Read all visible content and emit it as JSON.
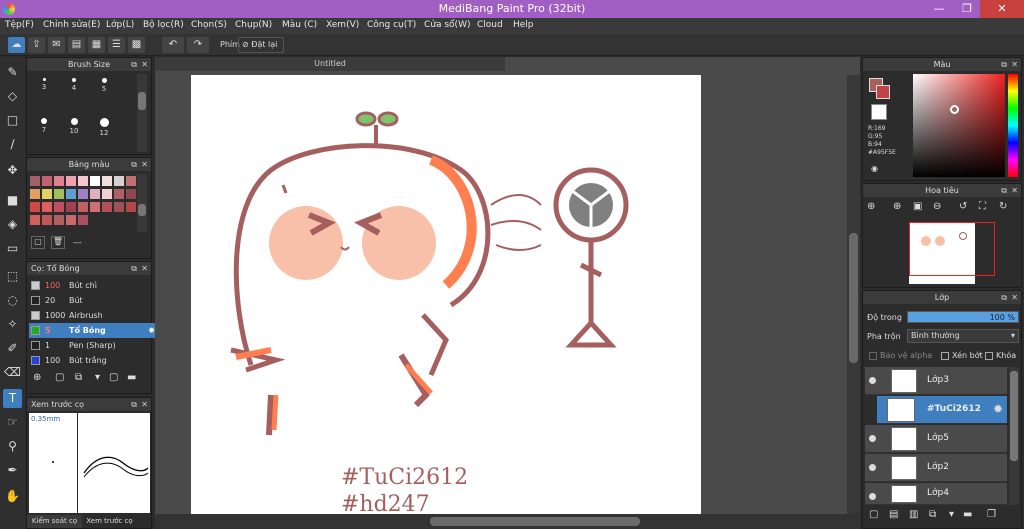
{
  "window": {
    "title": "MediBang Paint Pro (32bit)",
    "minimize": "—",
    "maximize": "❐",
    "close": "✕"
  },
  "menu": [
    "Tệp(F)",
    "Chỉnh sửa(E)",
    "Lớp(L)",
    "Bộ lọc(R)",
    "Chọn(S)",
    "Chụp(N)",
    "Màu (C)",
    "Xem(V)",
    "Công cụ(T)",
    "Cửa sổ(W)",
    "Cloud",
    "Help"
  ],
  "toolbar": {
    "phim_label": "Phím",
    "reset_label": "Đặt lại"
  },
  "brush_size": {
    "title": "Brush Size",
    "sizes": [
      "3",
      "4",
      "5",
      "7",
      "10",
      "12"
    ]
  },
  "palette": {
    "title": "Bảng màu",
    "footer": "---",
    "colors": [
      "#a0606a",
      "#c06070",
      "#e08090",
      "#f0a0b0",
      "#f7c7d0",
      "#ffffff",
      "#f0e0e0",
      "#d8d0d0",
      "#c07070",
      "#e0a060",
      "#e0d060",
      "#a0c060",
      "#60a0d0",
      "#a080c0",
      "#e0b0c0",
      "#f0d0d0",
      "#b06068",
      "#904850",
      "#d04848",
      "#e06060",
      "#c05060",
      "#a04050",
      "#c06060",
      "#d07070",
      "#b05058",
      "#a05058",
      "#b04848",
      "#d06060",
      "#c05858",
      "#b06060",
      "#c86868",
      "#a85060"
    ]
  },
  "brush_panel": {
    "title": "Cọ: Tổ Bóng",
    "brushes": [
      {
        "size": "100",
        "name": "Bút chì",
        "color": "#cccccc"
      },
      {
        "size": "20",
        "name": "Bút",
        "color": "#222222"
      },
      {
        "size": "1000",
        "name": "Airbrush",
        "color": "#cccccc"
      },
      {
        "size": "5",
        "name": "Tổ Bóng",
        "color": "#22aa22"
      },
      {
        "size": "1",
        "name": "Pen (Sharp)",
        "color": "#222222"
      },
      {
        "size": "100",
        "name": "Bút trắng",
        "color": "#2244dd"
      }
    ]
  },
  "brush_preview": {
    "title": "Xem trước cọ",
    "size_label": "0.35mm",
    "tabs": [
      "Kiểm soát cọ",
      "Xem trước cọ"
    ]
  },
  "document": {
    "tab": "Untitled",
    "hashtag1": "#TuCi2612",
    "hashtag2": "#hd247"
  },
  "color_panel": {
    "title": "Màu",
    "r": "R:169",
    "g": "G:95",
    "b": "B:94",
    "hex": "#A95F5E",
    "accent": "#a95f5e"
  },
  "navigator": {
    "title": "Hoa tiêu"
  },
  "layers": {
    "title": "Lớp",
    "opacity_label": "Độ trong",
    "opacity_value": "100 %",
    "opacity": 1.0,
    "blend_label": "Pha trộn",
    "blend_value": "Bình thường",
    "protect_alpha": "Bảo vệ alpha",
    "clipping": "Xén bớt",
    "lock": "Khóa",
    "items": [
      {
        "name": "Lớp3"
      },
      {
        "name": "#TuCi2612"
      },
      {
        "name": "Lớp5"
      },
      {
        "name": "Lớp2"
      },
      {
        "name": "Lớp4"
      }
    ]
  }
}
